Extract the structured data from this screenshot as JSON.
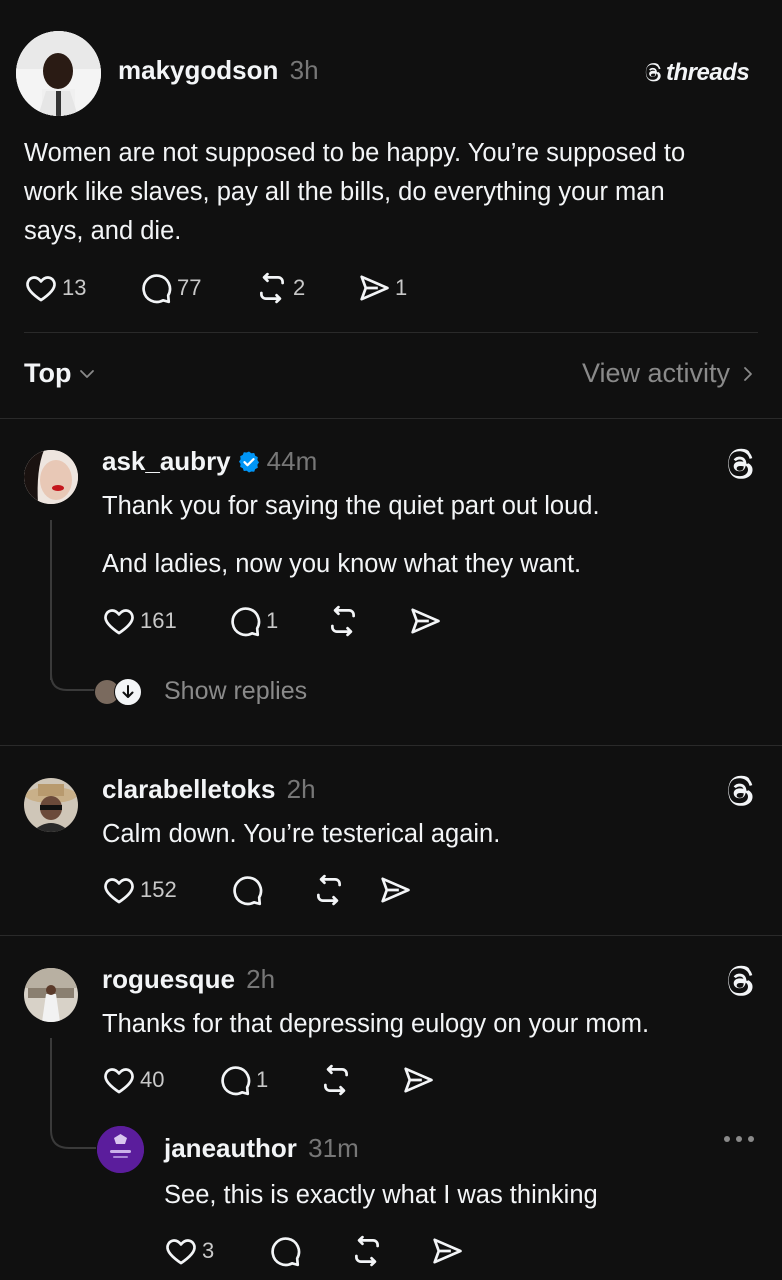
{
  "post": {
    "username": "makygodson",
    "time": "3h",
    "brand": "threads",
    "text_lines": [
      "Women are not supposed to be happy. You’re supposed to",
      "work like slaves, pay all the bills, do everything your man",
      "says, and die."
    ],
    "likes": "13",
    "replies": "77",
    "reposts": "2",
    "shares": "1"
  },
  "sort": {
    "label": "Top",
    "view_activity": "View activity"
  },
  "replies": [
    {
      "username": "ask_aubry",
      "verified": true,
      "time": "44m",
      "text_line1": "Thank you for saying the quiet part out loud.",
      "text_line2": "And ladies, now you know what they want.",
      "likes": "161",
      "replies": "1",
      "show_replies": "Show replies"
    },
    {
      "username": "clarabelletoks",
      "time": "2h",
      "text_line1": "Calm down. You’re testerical again.",
      "likes": "152"
    },
    {
      "username": "roguesque",
      "time": "2h",
      "text_line1": "Thanks for that depressing eulogy on your mom.",
      "likes": "40",
      "replies": "1"
    }
  ],
  "nested_reply": {
    "username": "janeauthor",
    "time": "31m",
    "text_line1": "See, this is exactly what I was thinking",
    "likes": "3"
  },
  "colors": {
    "background": "#101010",
    "verified": "#0095f6",
    "jane_avatar": "#5b1d9c"
  }
}
